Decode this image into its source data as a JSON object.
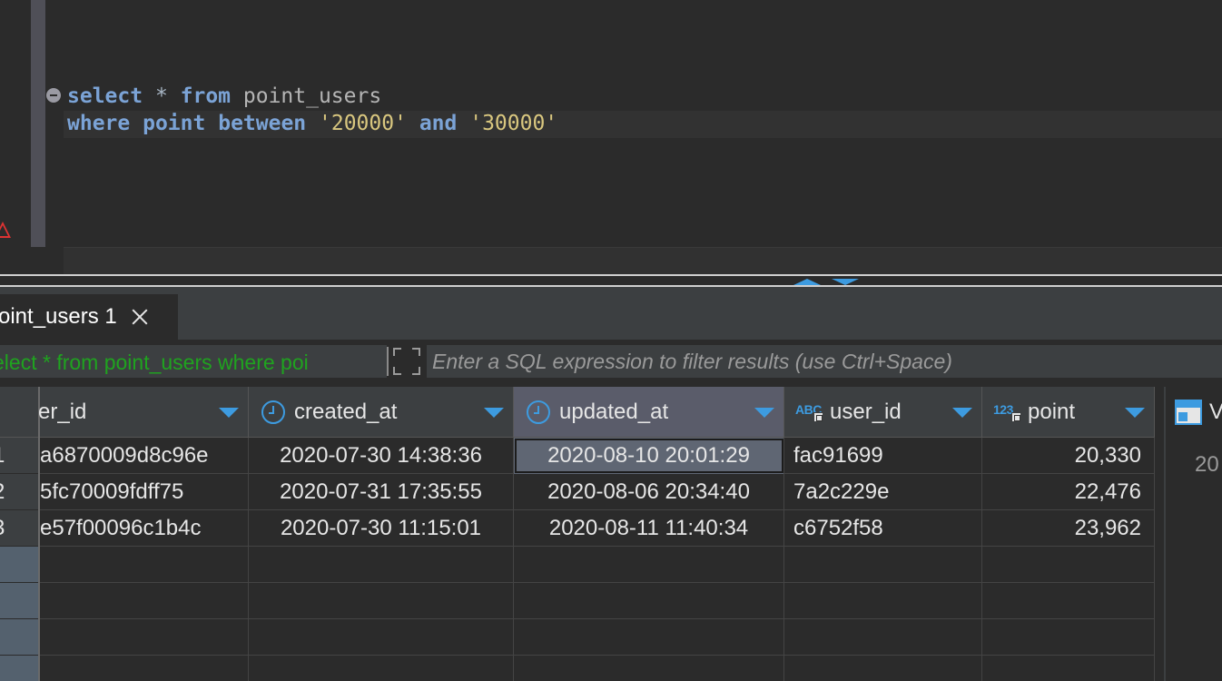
{
  "editor": {
    "line1": {
      "kw1": "select",
      "star": " * ",
      "kw2": "from",
      "ident": " point_users"
    },
    "line2": {
      "kw1": "where",
      "sp1": " ",
      "col": "point",
      "sp2": " ",
      "kw2": "between",
      "sp3": " ",
      "v1": "'20000'",
      "sp4": " ",
      "kw3": "and",
      "sp5": " ",
      "v2": "'30000'"
    }
  },
  "results": {
    "tab_label": "oint_users 1",
    "filter_sql": "elect * from point_users where poi",
    "filter_placeholder": "Enter a SQL expression to filter results (use Ctrl+Space)"
  },
  "grid": {
    "columns": [
      {
        "label": "er_id",
        "icon": "none"
      },
      {
        "label": "created_at",
        "icon": "clock-icon"
      },
      {
        "label": "updated_at",
        "icon": "clock-icon"
      },
      {
        "label": "user_id",
        "icon": "string-type-icon",
        "type_text": "ABC"
      },
      {
        "label": "point",
        "icon": "number-type-icon",
        "type_text": "123"
      }
    ],
    "rownums": [
      "1",
      "2",
      "3"
    ],
    "rows": [
      [
        "a6870009d8c96e",
        "2020-07-30 14:38:36",
        "2020-08-10 20:01:29",
        "fac91699",
        "20,330"
      ],
      [
        "5fc70009fdff75",
        "2020-07-31 17:35:55",
        "2020-08-06 20:34:40",
        "7a2c229e",
        "22,476"
      ],
      [
        "e57f00096c1b4c",
        "2020-07-30 11:15:01",
        "2020-08-11 11:40:34",
        "c6752f58",
        "23,962"
      ]
    ]
  },
  "value_panel": {
    "title": "V",
    "value": "20"
  },
  "colors": {
    "accent": "#3d9be0",
    "keyword": "#7ba3d6",
    "string": "#d9c77f",
    "filter_sql": "#1fa31f"
  }
}
